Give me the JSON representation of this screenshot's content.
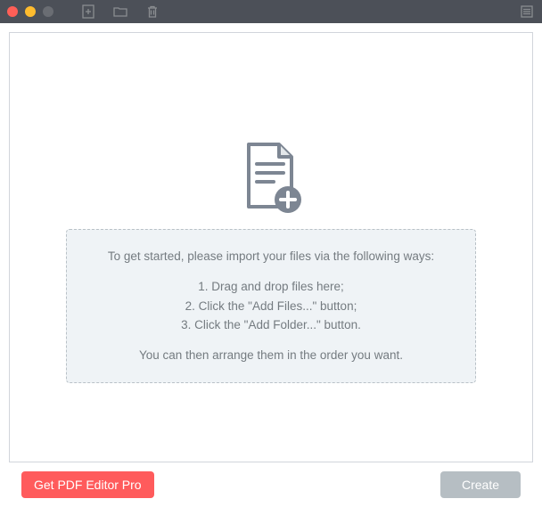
{
  "instructions": {
    "intro": "To get started, please import your files via the following ways:",
    "step1": "1. Drag and drop files here;",
    "step2": "2. Click the \"Add Files...\" button;",
    "step3": "3. Click the \"Add Folder...\" button.",
    "footer": "You can then arrange them in the order you want."
  },
  "buttons": {
    "get_pro": "Get PDF Editor Pro",
    "create": "Create"
  }
}
